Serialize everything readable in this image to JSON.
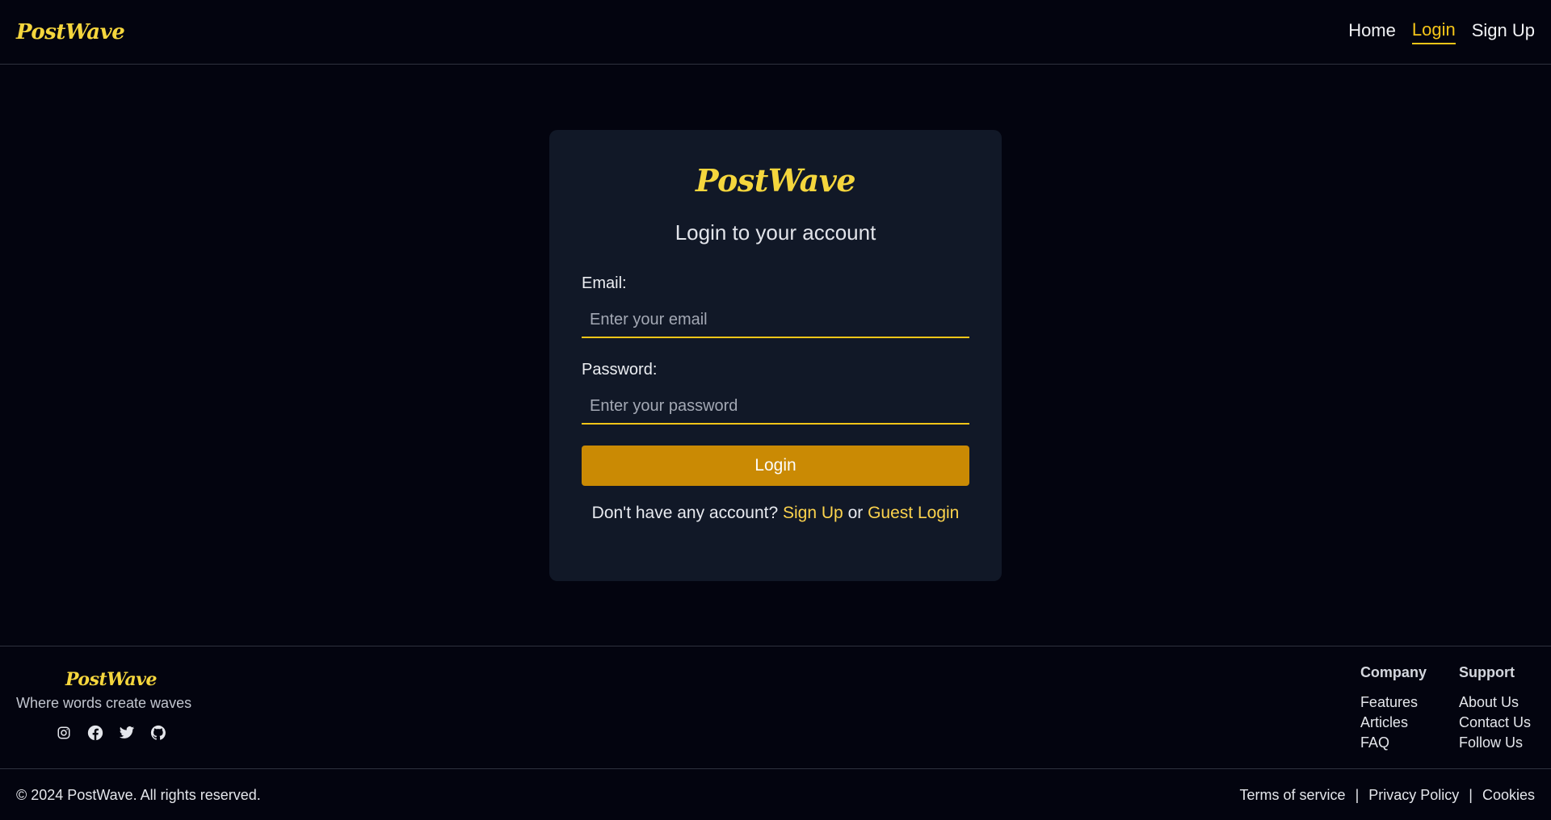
{
  "header": {
    "logo": "PostWave",
    "nav": [
      {
        "label": "Home"
      },
      {
        "label": "Login"
      },
      {
        "label": "Sign Up"
      }
    ]
  },
  "login_card": {
    "logo": "PostWave",
    "title": "Login to your account",
    "email_label": "Email:",
    "email_placeholder": "Enter your email",
    "password_label": "Password:",
    "password_placeholder": "Enter your password",
    "login_button": "Login",
    "no_account_text": "Don't have any account?",
    "signup_link": "Sign Up",
    "or_text": "or",
    "guest_link": "Guest Login"
  },
  "footer": {
    "logo": "PostWave",
    "tagline": "Where words create waves",
    "socials": [
      "instagram-icon",
      "facebook-icon",
      "twitter-icon",
      "github-icon"
    ],
    "company": {
      "title": "Company",
      "links": [
        "Features",
        "Articles",
        "FAQ"
      ]
    },
    "support": {
      "title": "Support",
      "links": [
        "About Us",
        "Contact Us",
        "Follow Us"
      ]
    },
    "copyright": "© 2024 PostWave. All rights reserved.",
    "legal": [
      "Terms of service",
      "Privacy Policy",
      "Cookies"
    ],
    "separator": "|"
  },
  "colors": {
    "background": "#03040f",
    "card": "#111827",
    "accent": "#f5c518",
    "button": "#ca8a04",
    "link": "#fcd34d"
  }
}
